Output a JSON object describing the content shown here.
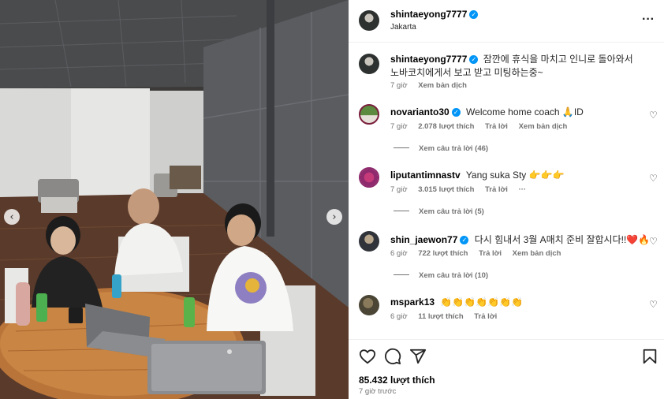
{
  "post": {
    "owner": "shintaeyong7777",
    "location": "Jakarta",
    "more_icon": "more-horizontal-icon"
  },
  "caption": {
    "username": "shintaeyong7777",
    "text": "잠깐에 휴식을 마치고 인니로 돌아와서 노바코치에게서 보고 받고 미팅하는중~",
    "time": "7 giờ",
    "translate": "Xem bản dịch"
  },
  "comments": [
    {
      "username": "novarianto30",
      "verified": true,
      "text": "Welcome home coach 🙏ID",
      "time": "7 giờ",
      "likes": "2.078 lượt thích",
      "reply": "Trả lời",
      "translate": "Xem bản dịch",
      "view_replies": "Xem câu trả lời (46)"
    },
    {
      "username": "liputantimnastv",
      "verified": false,
      "text": "Yang suka Sty 👉👉👉",
      "time": "7 giờ",
      "likes": "3.015 lượt thích",
      "reply": "Trả lời",
      "view_replies": "Xem câu trả lời (5)"
    },
    {
      "username": "shin_jaewon77",
      "verified": true,
      "text": "다시 힘내서 3월 A매치 준비 잘합시다!!❤️🔥",
      "time": "6 giờ",
      "likes": "722 lượt thích",
      "reply": "Trả lời",
      "translate": "Xem bản dịch",
      "view_replies": "Xem câu trả lời (10)"
    },
    {
      "username": "mspark13",
      "verified": false,
      "text": "👏👏👏👏👏👏👏",
      "time": "6 giờ",
      "likes": "11 lượt thích",
      "reply": "Trả lời"
    }
  ],
  "actions": {
    "like_icon": "heart-icon",
    "comment_icon": "comment-icon",
    "share_icon": "share-icon",
    "save_icon": "bookmark-icon",
    "likes_count": "85.432 lượt thích",
    "time_ago": "7 giờ trước"
  },
  "carousel": {
    "prev_icon": "chevron-left-icon",
    "next_icon": "chevron-right-icon"
  },
  "colors": {
    "verified": "#0095f6",
    "muted": "#737373",
    "divider": "#efefef"
  }
}
